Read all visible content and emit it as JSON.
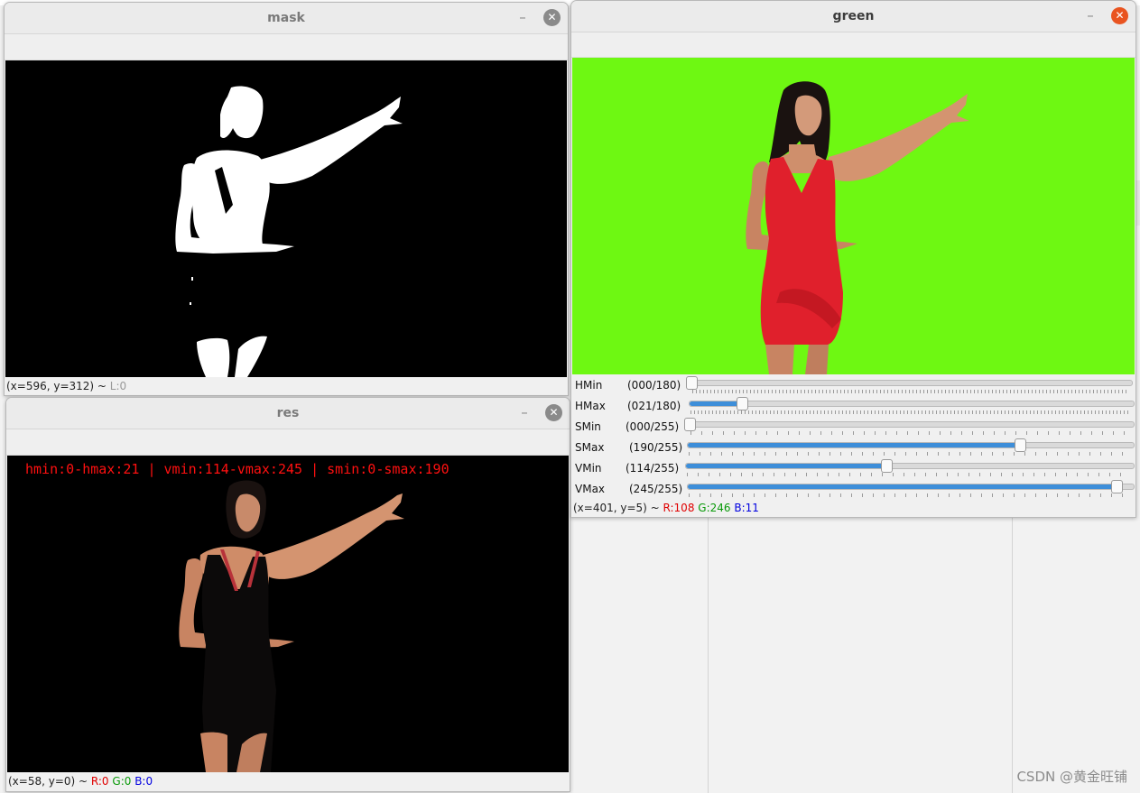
{
  "windows": {
    "mask": {
      "title": "mask",
      "status": {
        "coords": "(x=596, y=312) ~ ",
        "level": "L:0"
      }
    },
    "res": {
      "title": "res",
      "overlay": "hmin:0-hmax:21 | vmin:114-vmax:245 | smin:0-smax:190",
      "status": {
        "coords": "(x=58, y=0) ~ ",
        "r": "R:0",
        "g": "G:0",
        "b": "B:0"
      }
    },
    "green": {
      "title": "green",
      "trackbars": [
        {
          "name": "HMin",
          "value": "(000/180)",
          "level": 0
        },
        {
          "name": "HMax",
          "value": "(021/180)",
          "level": 0.117
        },
        {
          "name": "SMin",
          "value": "(000/255)",
          "level": 0
        },
        {
          "name": "SMax",
          "value": "(190/255)",
          "level": 0.745
        },
        {
          "name": "VMin",
          "value": "(114/255)",
          "level": 0.447
        },
        {
          "name": "VMax",
          "value": "(245/255)",
          "level": 0.961
        }
      ],
      "status": {
        "coords": "(x=401, y=5) ~ ",
        "r": "R:108",
        "g": "G:246",
        "b": "B:11"
      }
    }
  },
  "controls": {
    "minimize": "–",
    "close": "✕"
  },
  "watermark": "CSDN @黄金旺铺",
  "colors": {
    "chroma_green": "#6ef812",
    "dress_red": "#e0202c",
    "accent": "#e95420",
    "slider_fill": "#3d8ed9"
  }
}
